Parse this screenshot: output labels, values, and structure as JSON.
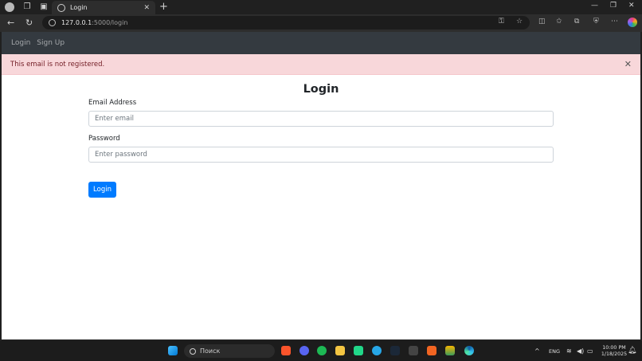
{
  "browser": {
    "tab_title": "Login",
    "url_host": "127.0.0.1",
    "url_path": ":5000/login"
  },
  "navbar": {
    "links": [
      "Login",
      "Sign Up"
    ]
  },
  "alert": {
    "message": "This email is not registered."
  },
  "form": {
    "title": "Login",
    "email_label": "Email Address",
    "email_placeholder": "Enter email",
    "password_label": "Password",
    "password_placeholder": "Enter password",
    "submit_label": "Login"
  },
  "taskbar": {
    "search_placeholder": "Поиск",
    "language": "ENG",
    "time": "10:00 PM",
    "date": "1/18/2025"
  },
  "colors": {
    "primary": "#007bff",
    "navbar_bg": "#343a40",
    "alert_bg": "#f8d7da",
    "alert_text": "#721c24"
  }
}
